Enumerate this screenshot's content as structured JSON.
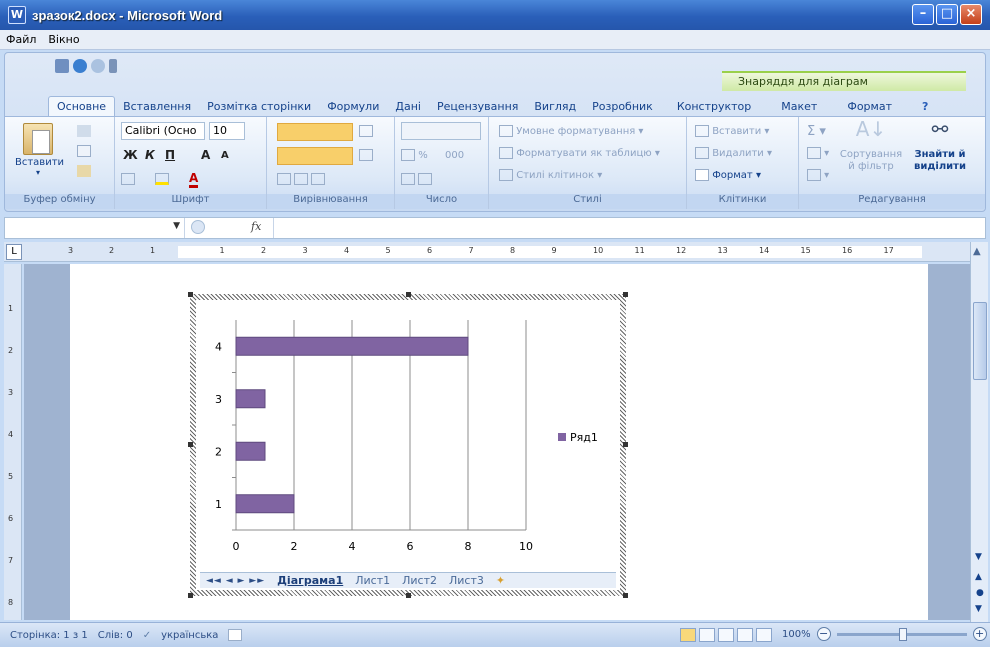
{
  "window": {
    "title": "зразок2.docx - Microsoft Word",
    "buttons": {
      "minimize": "–",
      "maximize": "□",
      "close": "×"
    }
  },
  "menu": [
    "Файл",
    "Вікно"
  ],
  "context_tools_label": "Знаряддя для діаграм",
  "tabs": [
    "Основне",
    "Вставлення",
    "Розмітка сторінки",
    "Формули",
    "Дані",
    "Рецензування",
    "Вигляд",
    "Розробник",
    "Конструктор",
    "Макет",
    "Формат"
  ],
  "active_tab": "Основне",
  "ribbon": {
    "clipboard": {
      "paste_label": "Вставити",
      "group": "Буфер обміну"
    },
    "font": {
      "family": "Calibri (Осно",
      "size": "10",
      "group": "Шрифт",
      "bold": "Ж",
      "italic": "К",
      "underline": "П",
      "grow": "A",
      "shrink": "A",
      "color": "A"
    },
    "alignment": {
      "group": "Вирівнювання"
    },
    "number": {
      "group": "Число",
      "percent": "%",
      "thousands": "000"
    },
    "styles": {
      "conditional": "Умовне форматування",
      "as_table": "Форматувати як таблицю",
      "cell_styles": "Стилі клітинок",
      "group": "Стилі"
    },
    "cells": {
      "insert": "Вставити",
      "delete": "Видалити",
      "format": "Формат",
      "group": "Клітинки"
    },
    "editing": {
      "sort": "Сортування й фільтр",
      "find": "Знайти й виділити",
      "group": "Редагування",
      "sigma": "Σ"
    }
  },
  "formula_bar": {
    "fx": "fx"
  },
  "ruler": {
    "ticks": [
      "3",
      "2",
      "1",
      "1",
      "2",
      "3",
      "4",
      "5",
      "6",
      "7",
      "8",
      "9",
      "10",
      "11",
      "12",
      "13",
      "14",
      "15",
      "16",
      "17"
    ],
    "vticks": [
      "1",
      "2",
      "3",
      "4",
      "5",
      "6",
      "7",
      "8"
    ],
    "tab_button": "L"
  },
  "chart_data": {
    "type": "bar",
    "orientation": "horizontal",
    "categories": [
      "1",
      "2",
      "3",
      "4"
    ],
    "series": [
      {
        "name": "Ряд1",
        "values": [
          2,
          1,
          1,
          8
        ],
        "color": "#8064a2"
      }
    ],
    "xlim": [
      0,
      10
    ],
    "xticks": [
      "0",
      "2",
      "4",
      "6",
      "8",
      "10"
    ],
    "grid": true,
    "legend": "right"
  },
  "sheet_tabs": [
    "Діаграма1",
    "Лист1",
    "Лист2",
    "Лист3"
  ],
  "active_sheet": "Діаграма1",
  "sheet_nav": "◄◄ ◄ ► ►►",
  "status": {
    "page": "Сторінка: 1 з 1",
    "words": "Слів: 0",
    "language": "українська",
    "zoom": "100%"
  },
  "colors": {
    "bar": "#8064a2",
    "bar_edge": "#5f4a7e"
  }
}
